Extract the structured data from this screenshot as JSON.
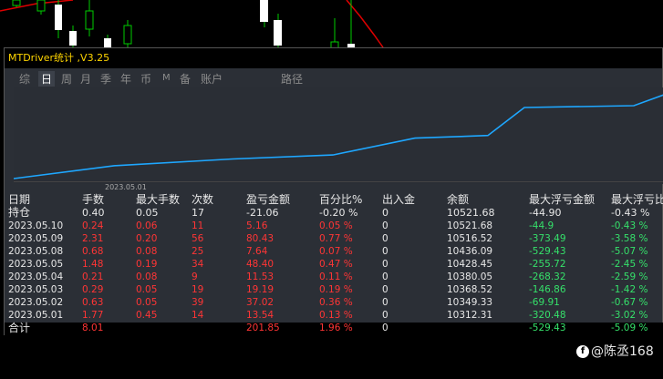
{
  "title": "MTDriver统计 ,V3.25",
  "tabs": [
    {
      "label": "综",
      "active": false
    },
    {
      "label": "日",
      "active": true
    },
    {
      "label": "周",
      "active": false
    },
    {
      "label": "月",
      "active": false
    },
    {
      "label": "季",
      "active": false
    },
    {
      "label": "年",
      "active": false
    },
    {
      "label": "币",
      "active": false
    },
    {
      "label": "M",
      "active": false
    },
    {
      "label": "备",
      "active": false
    },
    {
      "label": "账户",
      "active": false
    },
    {
      "label": "路径",
      "active": false
    }
  ],
  "curve": {
    "date_label": "2023.05.01",
    "color": "#1ea7ff",
    "points": [
      10312.31,
      10349.33,
      10368.52,
      10380.05,
      10428.45,
      10436.09,
      10516.52,
      10521.68,
      10521.68
    ]
  },
  "table": {
    "headers": [
      "日期",
      "手数",
      "最大手数",
      "次数",
      "盈亏金额",
      "百分比%",
      "出入金",
      "余额",
      "最大浮亏金额",
      "最大浮亏比"
    ],
    "holding": {
      "date": "持仓",
      "lots": "0.40",
      "max_lots": "0.05",
      "count": "17",
      "pnl": "-21.06",
      "pct": "-0.20 %",
      "deposit": "0",
      "balance": "10521.68",
      "max_dd": "-44.90",
      "max_dd_pct": "-0.43 %"
    },
    "rows": [
      {
        "date": "2023.05.10",
        "lots": "0.24",
        "max_lots": "0.06",
        "count": "11",
        "pnl": "5.16",
        "pct": "0.05 %",
        "deposit": "0",
        "balance": "10521.68",
        "max_dd": "-44.9",
        "max_dd_pct": "-0.43 %"
      },
      {
        "date": "2023.05.09",
        "lots": "2.31",
        "max_lots": "0.20",
        "count": "56",
        "pnl": "80.43",
        "pct": "0.77 %",
        "deposit": "0",
        "balance": "10516.52",
        "max_dd": "-373.49",
        "max_dd_pct": "-3.58 %"
      },
      {
        "date": "2023.05.08",
        "lots": "0.68",
        "max_lots": "0.08",
        "count": "25",
        "pnl": "7.64",
        "pct": "0.07 %",
        "deposit": "0",
        "balance": "10436.09",
        "max_dd": "-529.43",
        "max_dd_pct": "-5.07 %"
      },
      {
        "date": "2023.05.05",
        "lots": "1.48",
        "max_lots": "0.19",
        "count": "34",
        "pnl": "48.40",
        "pct": "0.47 %",
        "deposit": "0",
        "balance": "10428.45",
        "max_dd": "-255.72",
        "max_dd_pct": "-2.45 %"
      },
      {
        "date": "2023.05.04",
        "lots": "0.21",
        "max_lots": "0.08",
        "count": "9",
        "pnl": "11.53",
        "pct": "0.11 %",
        "deposit": "0",
        "balance": "10380.05",
        "max_dd": "-268.32",
        "max_dd_pct": "-2.59 %"
      },
      {
        "date": "2023.05.03",
        "lots": "0.29",
        "max_lots": "0.05",
        "count": "19",
        "pnl": "19.19",
        "pct": "0.19 %",
        "deposit": "0",
        "balance": "10368.52",
        "max_dd": "-146.86",
        "max_dd_pct": "-1.42 %"
      },
      {
        "date": "2023.05.02",
        "lots": "0.63",
        "max_lots": "0.05",
        "count": "39",
        "pnl": "37.02",
        "pct": "0.36 %",
        "deposit": "0",
        "balance": "10349.33",
        "max_dd": "-69.91",
        "max_dd_pct": "-0.67 %"
      },
      {
        "date": "2023.05.01",
        "lots": "1.77",
        "max_lots": "0.45",
        "count": "14",
        "pnl": "13.54",
        "pct": "0.13 %",
        "deposit": "0",
        "balance": "10312.31",
        "max_dd": "-320.48",
        "max_dd_pct": "-3.02 %"
      }
    ],
    "total": {
      "date": "合计",
      "lots": "8.01",
      "max_lots": "",
      "count": "",
      "pnl": "201.85",
      "pct": "1.96 %",
      "deposit": "0",
      "balance": "",
      "max_dd": "-529.43",
      "max_dd_pct": "-5.09 %"
    }
  },
  "watermark": "@陈丞168",
  "colors": {
    "positive": "#ff3535",
    "negative": "#35e06a",
    "title": "#ffd500"
  }
}
